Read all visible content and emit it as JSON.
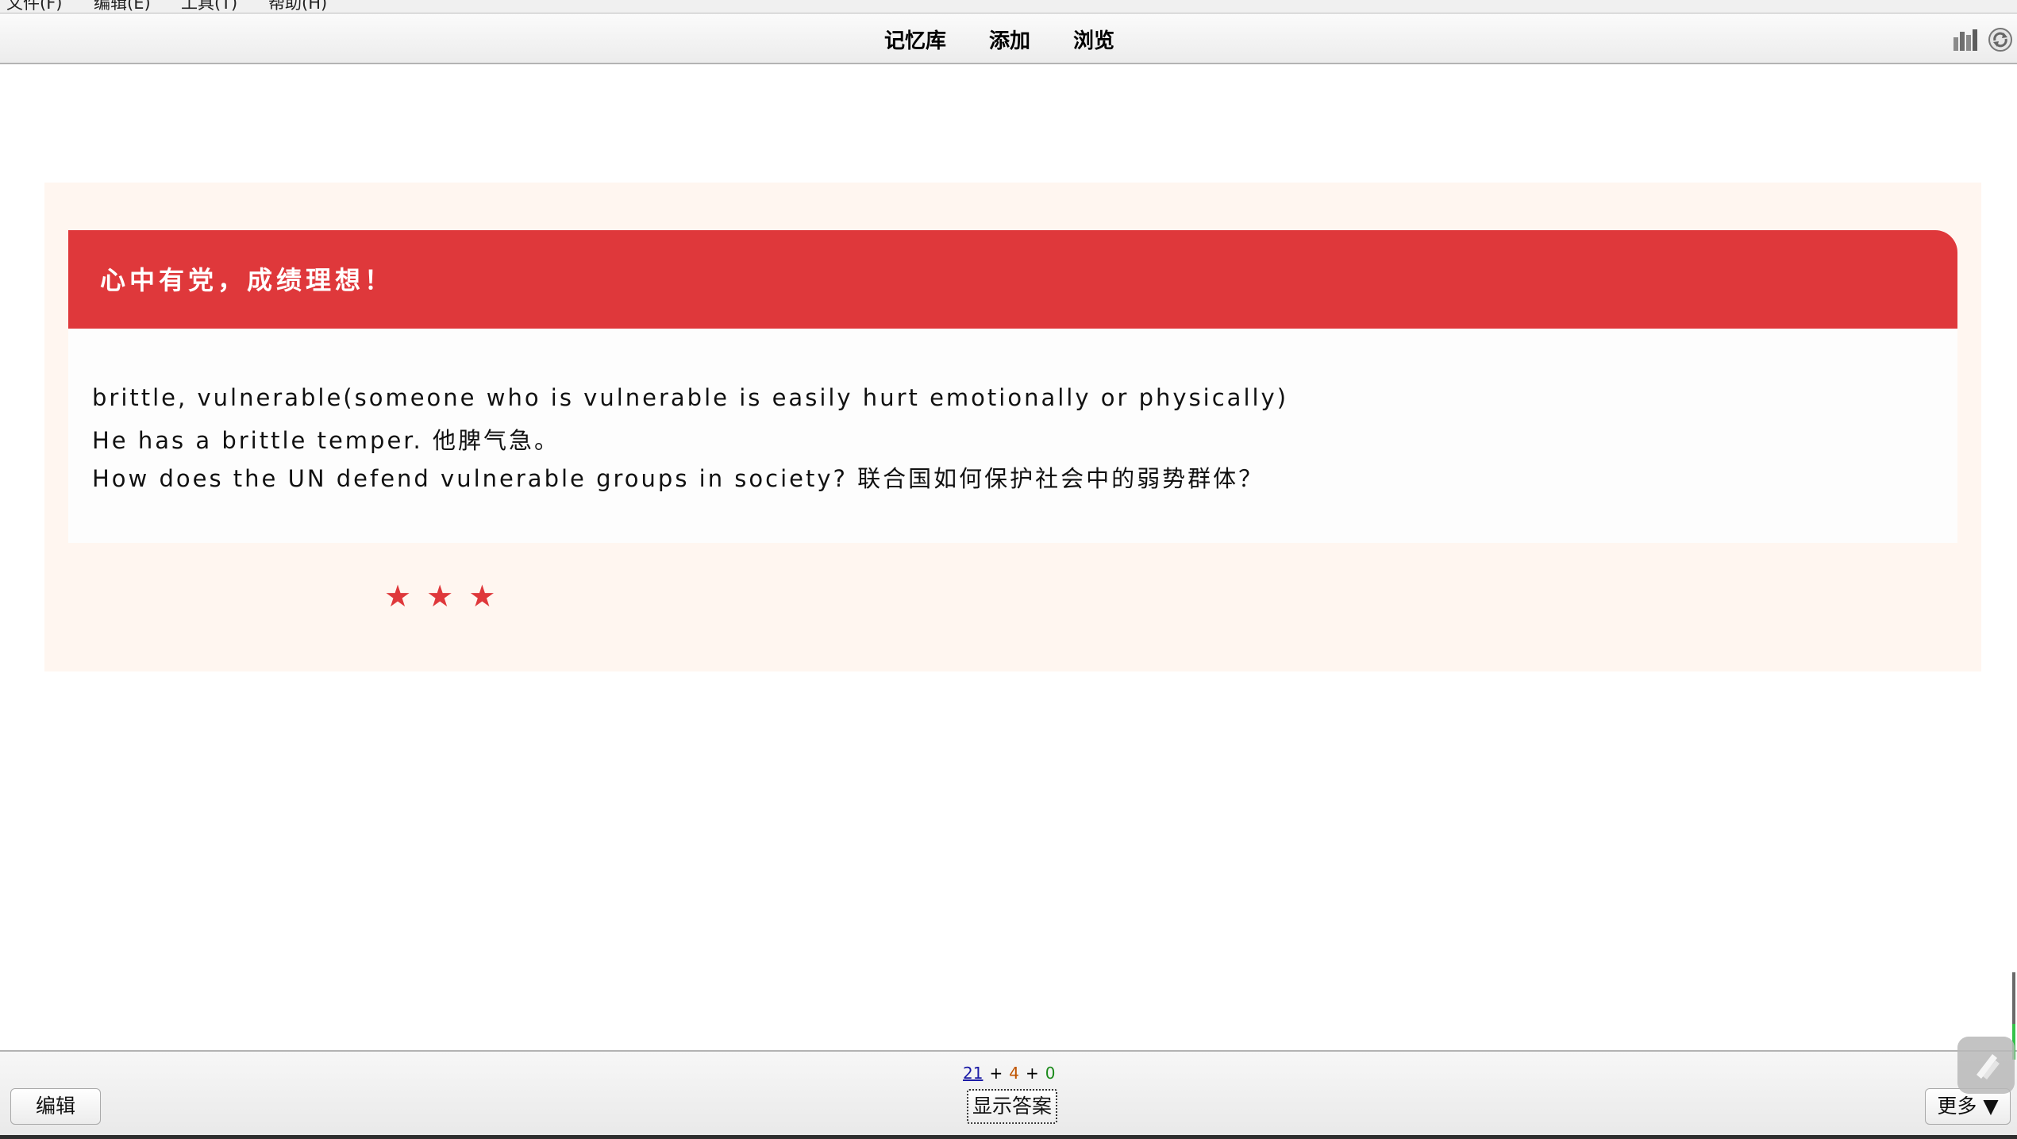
{
  "menubar": {
    "items": [
      "文件(F)",
      "编辑(E)",
      "工具(T)",
      "帮助(H)"
    ]
  },
  "toolbar": {
    "decks_label": "记忆库",
    "add_label": "添加",
    "browse_label": "浏览",
    "stats_icon": "bar-chart-icon",
    "sync_icon": "sync-icon"
  },
  "card": {
    "header": "心中有党，成绩理想！",
    "lines": [
      "brittle, vulnerable(someone who is vulnerable is easily hurt emotionally or physically)",
      "He has a brittle temper. 他脾气急。",
      "How does the UN defend vulnerable groups in society? 联合国如何保护社会中的弱势群体？"
    ],
    "stars": [
      "★",
      "★",
      "★"
    ],
    "colors": {
      "header_bg": "#df383b",
      "card_bg": "#fff6f0",
      "star": "#df383b"
    }
  },
  "bottombar": {
    "edit_label": "编辑",
    "show_answer_label": "显示答案",
    "more_label": "更多 ▼",
    "counts": {
      "new": "21",
      "sep1": "+",
      "learning": "4",
      "sep2": "+",
      "review": "0"
    }
  }
}
